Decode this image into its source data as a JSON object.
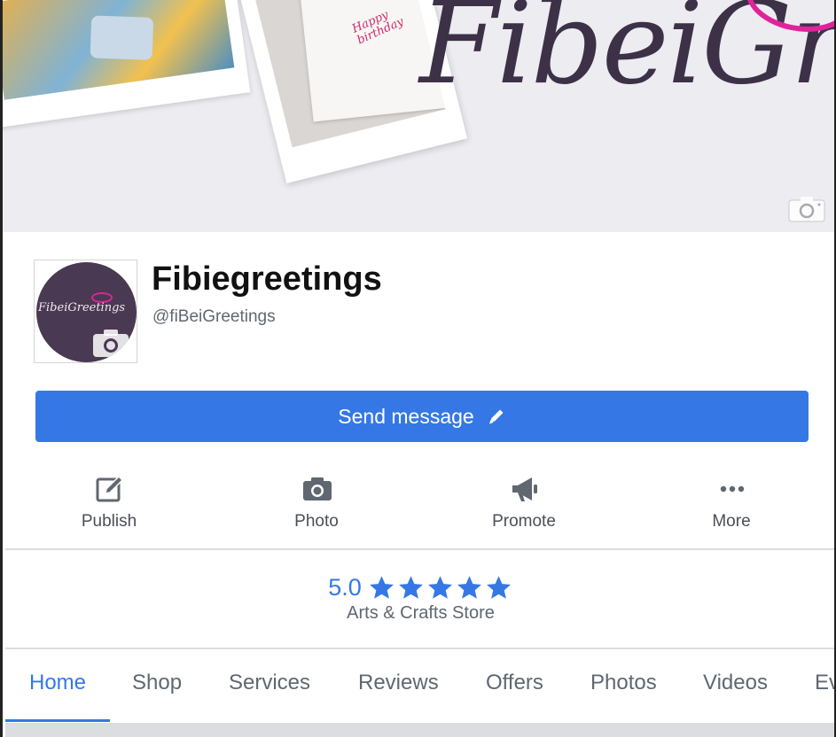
{
  "cover": {
    "brand_text": "FibeiGreet",
    "card_text": "Happy birthday",
    "camera_icon": "camera-icon"
  },
  "profile": {
    "avatar_text": "FibeiGreetings",
    "name": "Fibiegreetings",
    "handle": "@fiBeiGreetings"
  },
  "send_button": {
    "label": "Send message",
    "icon": "pencil-icon"
  },
  "actions": [
    {
      "label": "Publish",
      "icon": "edit-icon"
    },
    {
      "label": "Photo",
      "icon": "camera-icon"
    },
    {
      "label": "Promote",
      "icon": "megaphone-icon"
    },
    {
      "label": "More",
      "icon": "more-dots-icon"
    }
  ],
  "rating": {
    "value": "5.0",
    "stars": 5,
    "category": "Arts & Crafts Store"
  },
  "tabs": [
    {
      "label": "Home",
      "active": true
    },
    {
      "label": "Shop"
    },
    {
      "label": "Services"
    },
    {
      "label": "Reviews"
    },
    {
      "label": "Offers"
    },
    {
      "label": "Photos"
    },
    {
      "label": "Videos"
    },
    {
      "label": "Ev"
    }
  ],
  "colors": {
    "accent": "#3578e5",
    "brand_purple": "#4a3952",
    "brand_pink": "#e0239a"
  }
}
